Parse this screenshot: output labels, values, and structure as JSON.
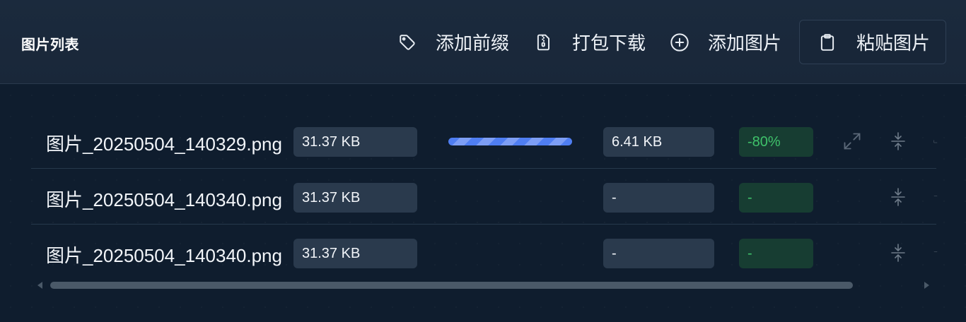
{
  "header": {
    "title": "图片列表",
    "buttons": {
      "add_prefix": "添加前缀",
      "pack_download": "打包下载",
      "add_image": "添加图片",
      "paste_image": "粘贴图片"
    }
  },
  "files": [
    {
      "name": "图片_20250504_140329.png",
      "original_size": "31.37 KB",
      "compressed_size": "6.41 KB",
      "ratio": "-80%",
      "progress": 1.0,
      "icons": [
        "expand-icon",
        "compress-icon"
      ]
    },
    {
      "name": "图片_20250504_140340.png",
      "original_size": "31.37 KB",
      "compressed_size": "-",
      "ratio": "-",
      "icons": [
        "compress-icon"
      ]
    },
    {
      "name": "图片_20250504_140340.png",
      "original_size": "31.37 KB",
      "compressed_size": "-",
      "ratio": "-",
      "icons": [
        "compress-icon"
      ]
    }
  ],
  "colors": {
    "background": "#0f1d2e",
    "header": "#1b2a3d",
    "chip": "#2a3a4d",
    "ratio_chip": "#173d32",
    "ratio_text": "#3fc26a",
    "progress": "#4f7ef2"
  }
}
